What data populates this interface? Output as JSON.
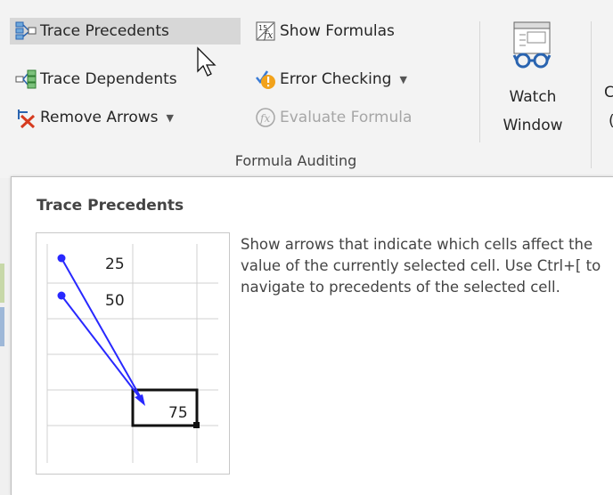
{
  "ribbon": {
    "trace_precedents": "Trace Precedents",
    "trace_dependents": "Trace Dependents",
    "remove_arrows": "Remove Arrows",
    "show_formulas": "Show Formulas",
    "error_checking": "Error Checking",
    "evaluate_formula": "Evaluate Formula",
    "watch_window_line1": "Watch",
    "watch_window_line2": "Window",
    "group_label": "Formula Auditing",
    "next_group_partial_line1": "C",
    "next_group_partial_line2": "("
  },
  "tooltip": {
    "title": "Trace Precedents",
    "description": "Show arrows that indicate which cells affect the value of the currently selected cell. Use Ctrl+[ to navigate to precedents of the selected cell.",
    "cells": {
      "a": "25",
      "b": "50",
      "result": "75"
    }
  },
  "colors": {
    "arrow": "#2828ff",
    "hover": "#d7d7d7",
    "disabled_text": "#a6a6a6"
  },
  "icons": [
    "trace-precedents-icon",
    "trace-dependents-icon",
    "remove-arrows-icon",
    "show-formulas-icon",
    "error-checking-icon",
    "evaluate-formula-icon",
    "watch-window-icon",
    "cursor-icon"
  ]
}
